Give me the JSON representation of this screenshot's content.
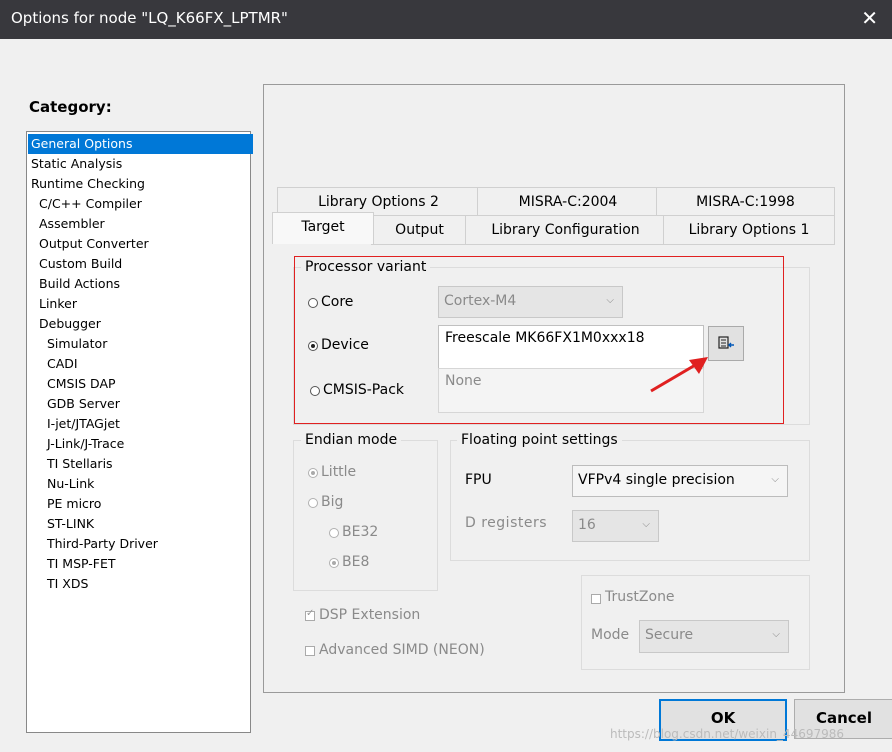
{
  "window": {
    "title": "Options for node \"LQ_K66FX_LPTMR\"",
    "close_glyph": "✕"
  },
  "category": {
    "label": "Category:",
    "items": [
      "General Options",
      "Static Analysis",
      "Runtime Checking",
      "C/C++ Compiler",
      "Assembler",
      "Output Converter",
      "Custom Build",
      "Build Actions",
      "Linker",
      "Debugger",
      "Simulator",
      "CADI",
      "CMSIS DAP",
      "GDB Server",
      "I-jet/JTAGjet",
      "J-Link/J-Trace",
      "TI Stellaris",
      "Nu-Link",
      "PE micro",
      "ST-LINK",
      "Third-Party Driver",
      "TI MSP-FET",
      "TI XDS"
    ],
    "selected": "General Options"
  },
  "tabs": {
    "row_back": [
      "Library Options 2",
      "MISRA-C:2004",
      "MISRA-C:1998"
    ],
    "row_front": [
      "Target",
      "Output",
      "Library Configuration",
      "Library Options 1"
    ],
    "active": "Target"
  },
  "processor": {
    "label": "Processor variant",
    "core_label": "Core",
    "core_value": "Cortex-M4",
    "device_label": "Device",
    "device_value": "Freescale MK66FX1M0xxx18",
    "cmsis_label": "CMSIS-Pack",
    "cmsis_value": "None",
    "selected": "Device"
  },
  "endian": {
    "label": "Endian mode",
    "little": "Little",
    "big": "Big",
    "be32": "BE32",
    "be8": "BE8"
  },
  "fpu": {
    "label": "Floating point settings",
    "fpu_label": "FPU",
    "fpu_value": "VFPv4 single precision",
    "dreg_label": "D registers",
    "dreg_value": "16"
  },
  "options": {
    "dsp": "DSP Extension",
    "simd": "Advanced SIMD (NEON)",
    "trustzone": "TrustZone",
    "mode_label": "Mode",
    "mode_value": "Secure"
  },
  "buttons": {
    "ok": "OK",
    "cancel": "Cancel"
  },
  "watermark": "https://blog.csdn.net/weixin_44697986",
  "colors": {
    "selection": "#0078d7",
    "annotation": "#e02020",
    "titlebar": "#38383d"
  }
}
